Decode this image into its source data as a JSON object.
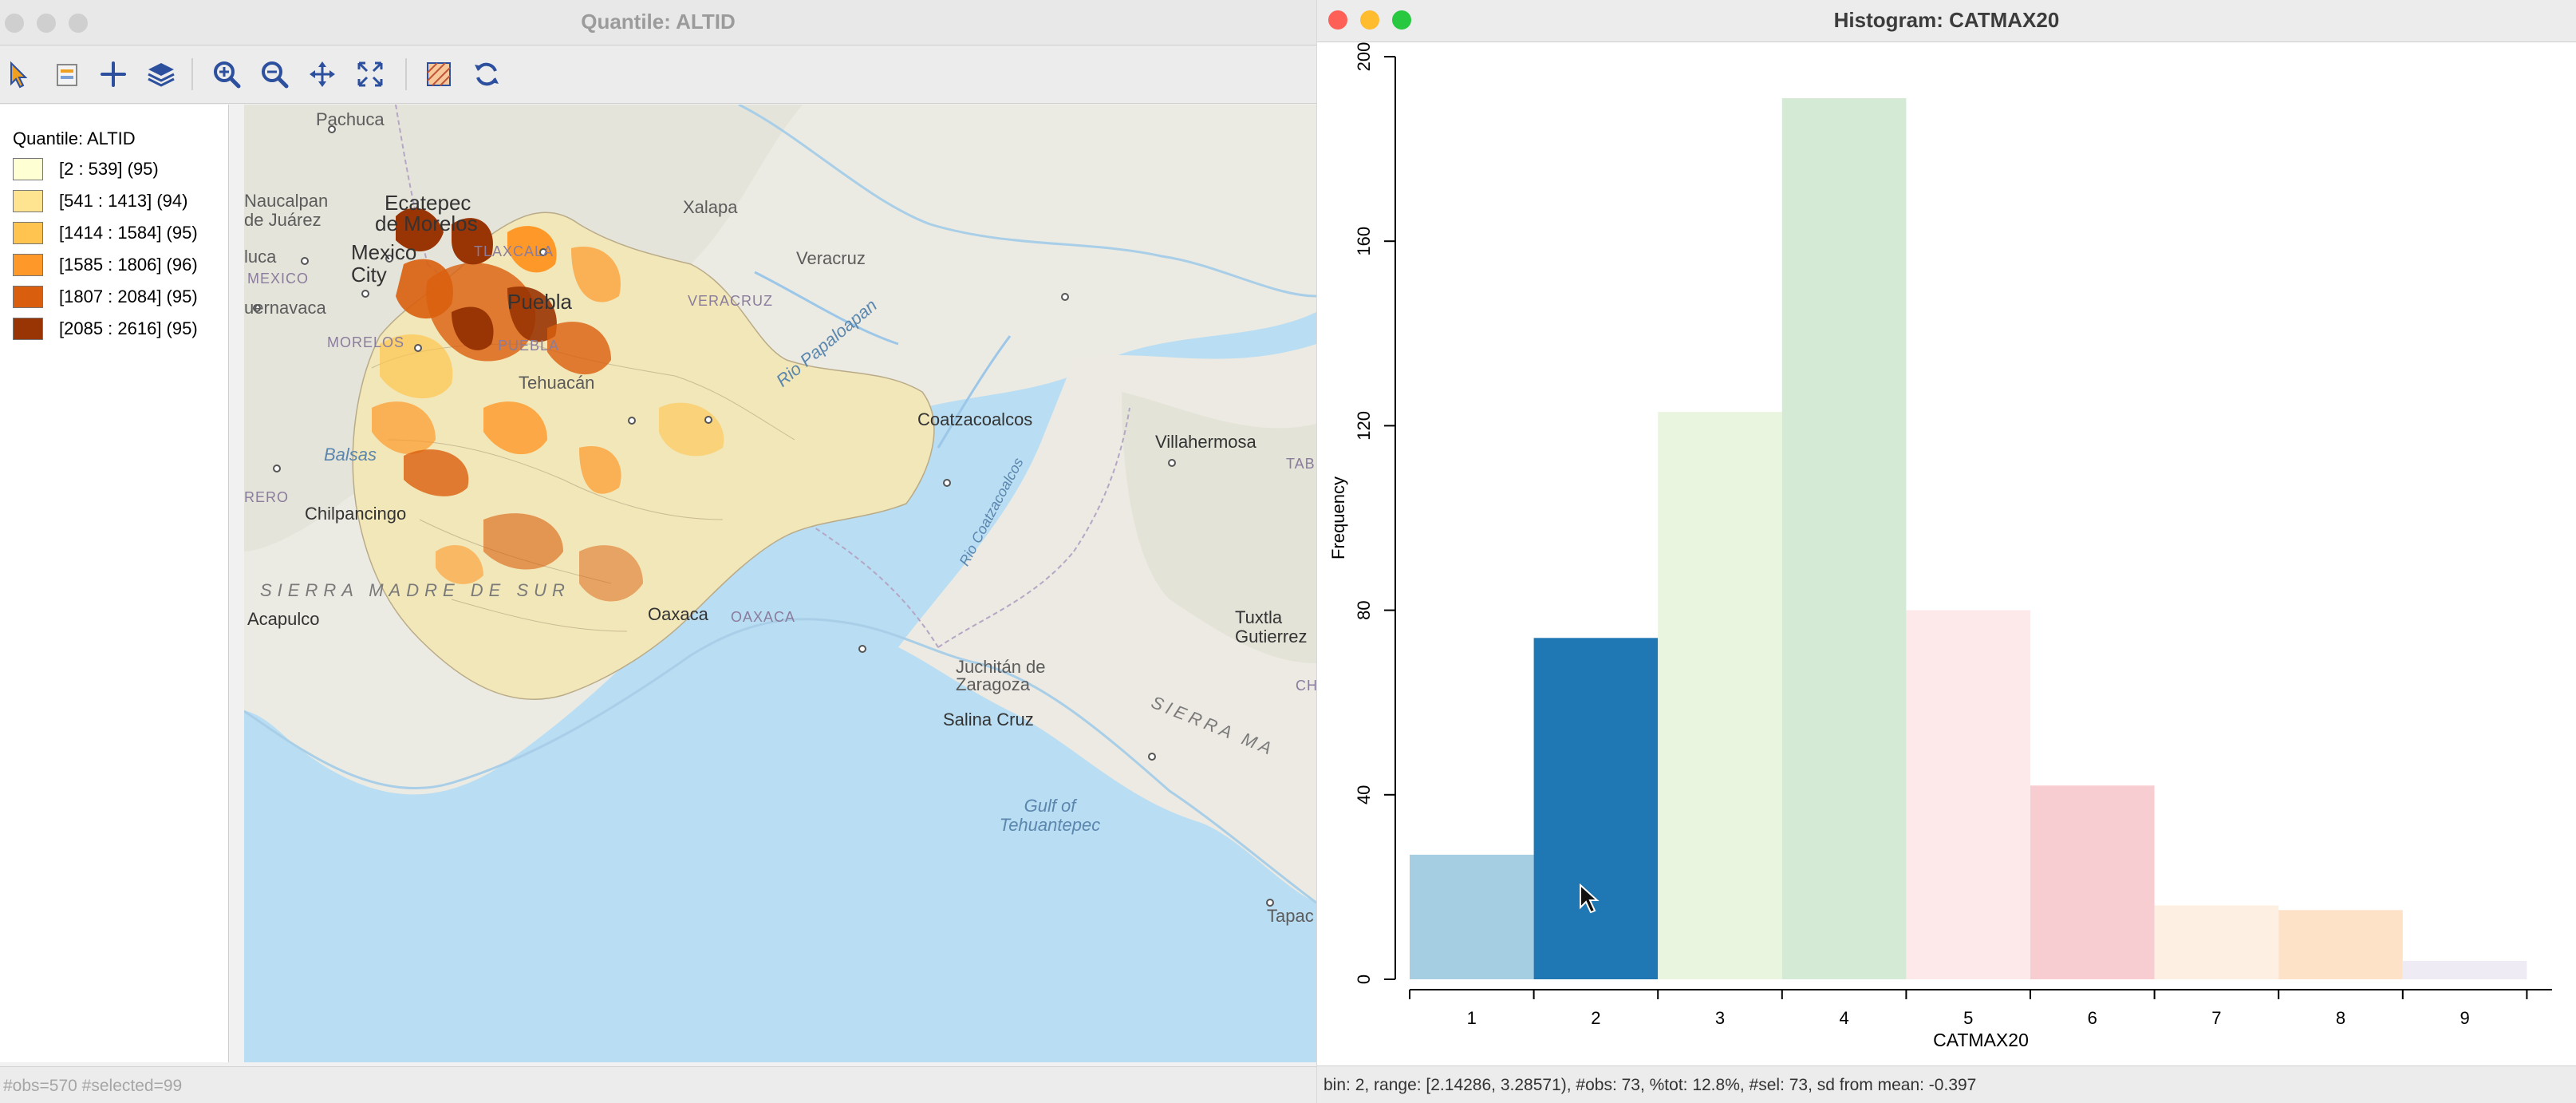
{
  "map_window": {
    "title": "Quantile: ALTID",
    "toolbar": [
      {
        "icon": "select-pointer-icon"
      },
      {
        "icon": "select-layer-icon"
      },
      {
        "icon": "add-plus-icon"
      },
      {
        "icon": "layers-icon"
      },
      {
        "icon": "zoom-in-icon"
      },
      {
        "icon": "zoom-out-icon"
      },
      {
        "icon": "pan-icon"
      },
      {
        "icon": "full-extent-icon"
      },
      {
        "icon": "basemap-icon"
      },
      {
        "icon": "refresh-icon"
      }
    ],
    "legend": {
      "title": "Quantile: ALTID",
      "items": [
        {
          "label": "[2 : 539] (95)",
          "color": "#ffffd4"
        },
        {
          "label": "[541 : 1413] (94)",
          "color": "#fee391"
        },
        {
          "label": "[1414 : 1584] (95)",
          "color": "#fec44f"
        },
        {
          "label": "[1585 : 1806] (96)",
          "color": "#fe9929"
        },
        {
          "label": "[1807 : 2084] (95)",
          "color": "#d95f0e"
        },
        {
          "label": "[2085 : 2616] (95)",
          "color": "#993404"
        }
      ]
    },
    "map_labels": {
      "pachuca": "Pachuca",
      "naucalpan": "Naucalpan",
      "de_juarez": "de Juárez",
      "ecatepec": "Ecatepec",
      "de_morelos": "de Morelos",
      "mexico": "Mexico",
      "city": "City",
      "tlaxcala": "TLAXCALA",
      "xalapa": "Xalapa",
      "veracruz_city": "Veracruz",
      "luca": "luca",
      "mexico_state": "MEXICO",
      "puebla_city": "Puebla",
      "veracruz_state": "VERACRUZ",
      "cuernavaca": "uernavaca",
      "morelos": "MORELOS",
      "puebla_state": "PUEBLA",
      "tehuacan": "Tehuacán",
      "rio_papaloapan": "Rio Papaloapan",
      "balsas": "Balsas",
      "coatzacoalcos": "Coatzacoalcos",
      "villahermosa": "Villahermosa",
      "tab": "TAB",
      "rio_coatzacoalcos": "Rio Coatzacoalcos",
      "rero": "RERO",
      "chilpancingo": "Chilpancingo",
      "sierra_madre": "SIERRA MADRE DE SUR",
      "oaxaca_city": "Oaxaca",
      "oaxaca_state": "OAXACA",
      "acapulco": "Acapulco",
      "tuxtla": "Tuxtla",
      "gutierrez": "Gutierrez",
      "juchitan": "Juchitán de",
      "zaragoza": "Zaragoza",
      "salina_cruz": "Salina Cruz",
      "sierra_chiapas": "SIERRA MA",
      "ch": "CH",
      "gulf_of": "Gulf of",
      "tehuantepec": "Tehuantepec",
      "tapac": "Tapac"
    },
    "status": "#obs=570 #selected=99"
  },
  "hist_window": {
    "title": "Histogram: CATMAX20",
    "status": "bin: 2, range: [2.14286, 3.28571), #obs: 73, %tot: 12.8%, #sel: 73, sd from mean: -0.397"
  },
  "chart_data": {
    "type": "bar",
    "categories": [
      "1",
      "2",
      "3",
      "4",
      "5",
      "6",
      "7",
      "8",
      "9"
    ],
    "values": [
      27,
      74,
      123,
      191,
      80,
      42,
      16,
      15,
      4
    ],
    "colors": [
      "#a6cee3",
      "#1f78b4",
      "#eaf5e0",
      "#d5ead4",
      "#fde8ea",
      "#f8cdd1",
      "#fdefe2",
      "#fde2c7",
      "#efebf5"
    ],
    "selected_bin": "2",
    "xlabel": "CATMAX20",
    "ylabel": "Frequency",
    "yticks": [
      0,
      40,
      80,
      120,
      160,
      200
    ],
    "ylim": [
      0,
      200
    ]
  }
}
